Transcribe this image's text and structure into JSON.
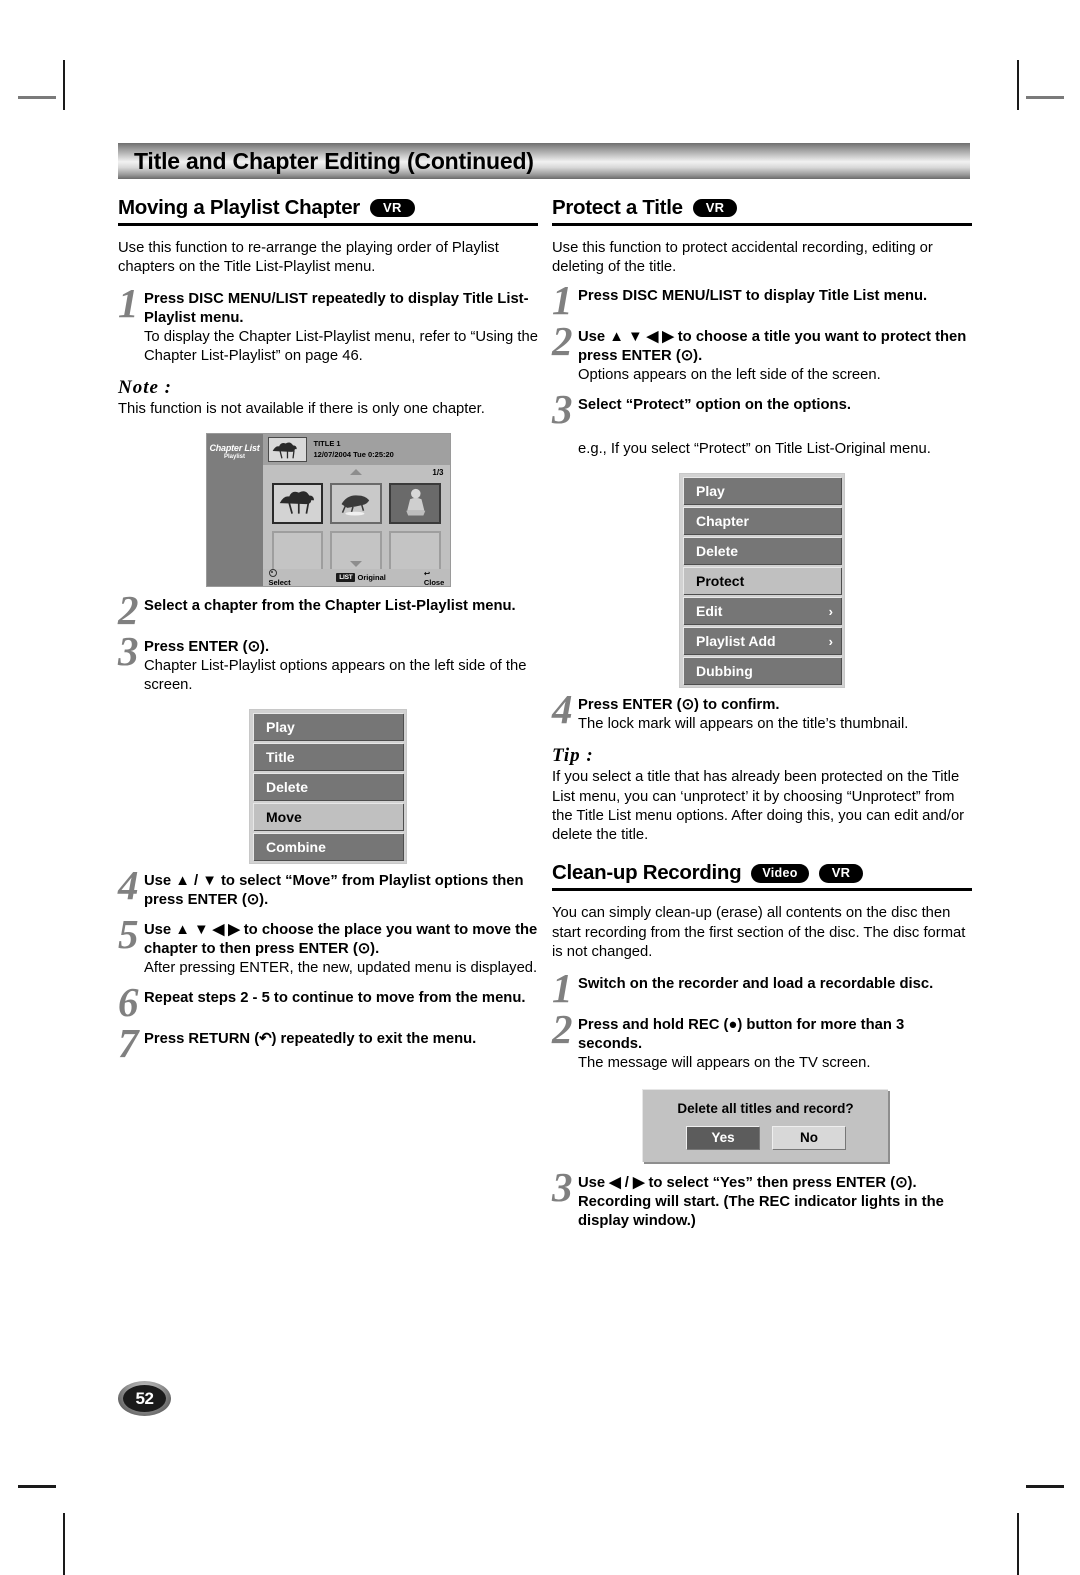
{
  "header": {
    "title": "Title and Chapter Editing (Continued)"
  },
  "page_number": "52",
  "left_column": {
    "section": {
      "heading": "Moving a Playlist Chapter",
      "badge": "VR",
      "intro": "Use this function to re-arrange the playing order of Playlist chapters on the Title List-Playlist menu."
    },
    "step1": {
      "num": "1",
      "bold": "Press DISC MENU/LIST repeatedly to display Title List-Playlist menu.",
      "sub": "To display the Chapter List-Playlist menu, refer to “Using the Chapter List-Playlist” on page 46."
    },
    "note": {
      "label": "Note :",
      "text": "This function is not available if there is only one chapter."
    },
    "screenshot": {
      "side_title": "Chapter List",
      "side_sub": "Playlist",
      "title": "TITLE 1",
      "datetime": "12/07/2004  Tue 0:25:20",
      "page_indicator": "1/3",
      "footer_select": "Select",
      "footer_key": "LIST",
      "footer_original": "Original",
      "footer_close": "Close"
    },
    "step2": {
      "num": "2",
      "bold": "Select a chapter from the Chapter List-Playlist menu."
    },
    "step3": {
      "num": "3",
      "bold": "Press ENTER (⊙).",
      "sub": "Chapter List-Playlist options appears on the left side of the screen."
    },
    "options_menu": {
      "items": [
        {
          "label": "Play",
          "highlighted": false,
          "submenu": false
        },
        {
          "label": "Title",
          "highlighted": false,
          "submenu": false
        },
        {
          "label": "Delete",
          "highlighted": false,
          "submenu": false
        },
        {
          "label": "Move",
          "highlighted": true,
          "submenu": false
        },
        {
          "label": "Combine",
          "highlighted": false,
          "submenu": false
        }
      ]
    },
    "step4": {
      "num": "4",
      "bold": "Use ▲ / ▼ to select “Move” from Playlist options then press ENTER (⊙)."
    },
    "step5": {
      "num": "5",
      "bold": "Use ▲ ▼ ◀ ▶ to choose the place you want to move the chapter to then press ENTER (⊙).",
      "sub": "After pressing ENTER, the new, updated menu is displayed."
    },
    "step6": {
      "num": "6",
      "bold": "Repeat steps 2 - 5 to continue to move from the menu."
    },
    "step7": {
      "num": "7",
      "bold": "Press RETURN (↶) repeatedly to exit the menu."
    }
  },
  "right_column": {
    "section": {
      "heading": "Protect a Title",
      "badge": "VR",
      "intro": "Use this function to protect accidental recording, editing or deleting of the title."
    },
    "step1": {
      "num": "1",
      "bold": "Press DISC MENU/LIST to display Title List menu."
    },
    "step2": {
      "num": "2",
      "bold": "Use ▲ ▼ ◀ ▶ to choose a title you want to protect then press ENTER (⊙).",
      "sub": "Options appears on the left side of the screen."
    },
    "step3": {
      "num": "3",
      "bold": "Select “Protect” option on the options."
    },
    "example_text": "e.g., If you select “Protect” on Title List-Original menu.",
    "options_menu": {
      "items": [
        {
          "label": "Play",
          "highlighted": false,
          "submenu": false
        },
        {
          "label": "Chapter",
          "highlighted": false,
          "submenu": false
        },
        {
          "label": "Delete",
          "highlighted": false,
          "submenu": false
        },
        {
          "label": "Protect",
          "highlighted": true,
          "submenu": false
        },
        {
          "label": "Edit",
          "highlighted": false,
          "submenu": true
        },
        {
          "label": "Playlist Add",
          "highlighted": false,
          "submenu": true
        },
        {
          "label": "Dubbing",
          "highlighted": false,
          "submenu": false
        }
      ],
      "submenu_arrow": "›"
    },
    "step4": {
      "num": "4",
      "bold": "Press ENTER (⊙) to confirm.",
      "sub": "The lock mark will appears on the title’s thumbnail."
    },
    "tip": {
      "label": "Tip :",
      "text": "If you select a title that has already been protected on the Title List menu, you can ‘unprotect’ it by choosing “Unprotect” from the Title List menu options. After doing this, you can edit and/or delete the title."
    },
    "cleanup": {
      "heading": "Clean-up Recording",
      "badge_video": "Video",
      "badge_vr": "VR",
      "intro": "You can simply clean-up (erase) all contents on the disc then start recording from the first section of the disc. The disc format is not changed.",
      "step1": {
        "num": "1",
        "bold": "Switch on the recorder and load a recordable disc."
      },
      "step2": {
        "num": "2",
        "bold": "Press and hold REC (●) button for more than 3 seconds.",
        "sub": "The message will appears on the TV screen."
      },
      "dialog": {
        "message": "Delete all titles and record?",
        "yes": "Yes",
        "no": "No"
      },
      "step3": {
        "num": "3",
        "bold": "Use ◀ / ▶ to select “Yes” then press ENTER (⊙).",
        "bold2": "Recording will start. (The REC indicator lights in the display window.)"
      }
    }
  }
}
